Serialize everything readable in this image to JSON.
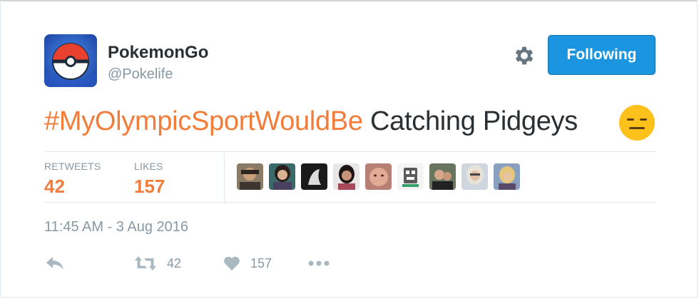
{
  "user": {
    "display_name": "PokemonGo",
    "handle": "@Pokelife"
  },
  "follow_button": {
    "label": "Following"
  },
  "tweet": {
    "hashtag": "#MyOlympicSportWouldBe",
    "text": " Catching Pidgeys"
  },
  "stats": {
    "retweets_label": "RETWEETS",
    "retweets_value": "42",
    "likes_label": "LIKES",
    "likes_value": "157"
  },
  "timestamp": "11:45 AM - 3 Aug 2016",
  "actions": {
    "retweet_count": "42",
    "like_count": "157"
  },
  "colors": {
    "accent": "#f27d3b",
    "button_blue": "#1b95e0",
    "muted": "#8899a6"
  },
  "icons": [
    "pokeball-avatar",
    "gear-icon",
    "expressionless-emoji",
    "reply-icon",
    "retweet-icon",
    "heart-icon",
    "more-icon"
  ]
}
